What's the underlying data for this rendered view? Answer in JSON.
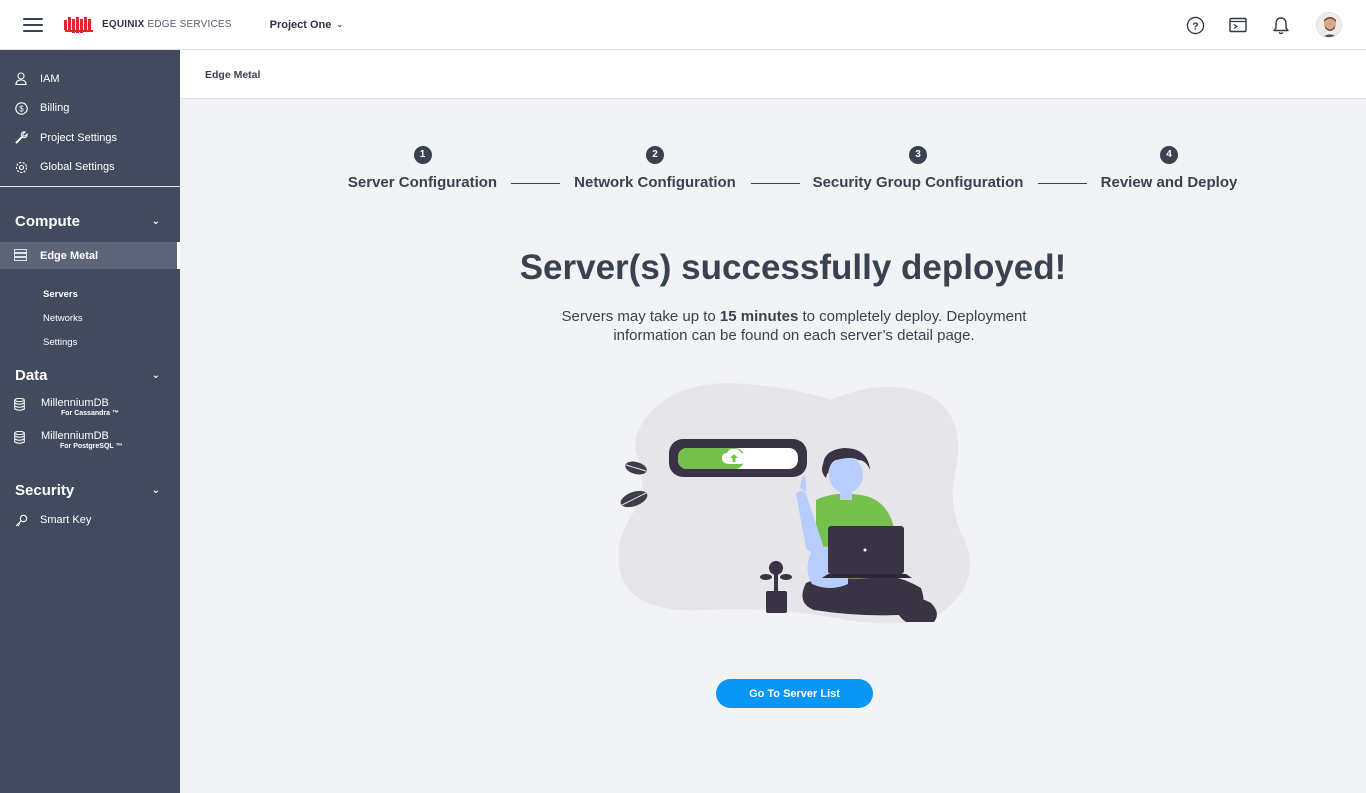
{
  "topbar": {
    "menu_icon": "hamburger-icon",
    "brand_bold": "EQUINIX",
    "brand_light": "EDGE SERVICES",
    "project": "Project One",
    "icons": [
      "help-icon",
      "terminal-icon",
      "bell-icon",
      "avatar"
    ]
  },
  "sidebar": {
    "top_items": [
      {
        "label": "IAM",
        "icon": "user-icon"
      },
      {
        "label": "Billing",
        "icon": "dollar-icon"
      },
      {
        "label": "Project Settings",
        "icon": "wrench-icon"
      },
      {
        "label": "Global Settings",
        "icon": "gear-icon"
      }
    ],
    "compute": {
      "title": "Compute",
      "active_item": "Edge Metal",
      "sub_items": [
        "Servers",
        "Networks",
        "Settings"
      ],
      "active_sub": "Servers"
    },
    "data": {
      "title": "Data",
      "items": [
        {
          "name": "MillenniumDB",
          "sub": "For Cassandra ™"
        },
        {
          "name": "MillenniumDB",
          "sub": "For PostgreSQL ™"
        }
      ]
    },
    "security": {
      "title": "Security",
      "items": [
        {
          "label": "Smart Key",
          "icon": "key-icon"
        }
      ]
    }
  },
  "breadcrumb": "Edge Metal",
  "stepper": {
    "steps": [
      {
        "num": "1",
        "label": "Server Configuration"
      },
      {
        "num": "2",
        "label": "Network Configuration"
      },
      {
        "num": "3",
        "label": "Security Group Configuration"
      },
      {
        "num": "4",
        "label": "Review and Deploy"
      }
    ]
  },
  "success": {
    "title": "Server(s) successfully deployed!",
    "text_before": "Servers may take up to ",
    "text_bold": "15 minutes",
    "text_after": " to completely deploy. Deployment information can be found on each server’s detail page."
  },
  "illustration": {
    "progress": 0.55,
    "colors": {
      "accent_green": "#76c04e",
      "skin": "#b7cdfc",
      "dark": "#3a3346"
    }
  },
  "button": {
    "label": "Go To Server List",
    "color": "#0a96f5"
  }
}
